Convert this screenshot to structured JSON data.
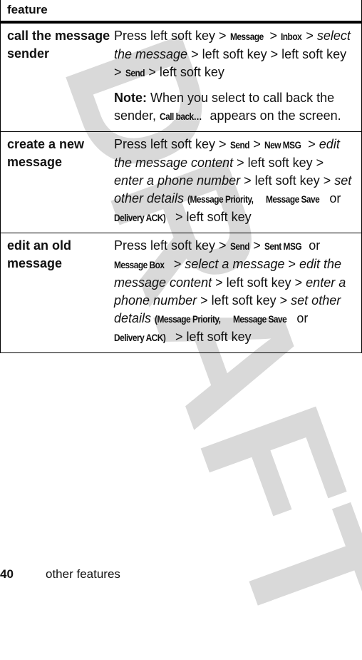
{
  "watermark": "DRAFT",
  "table": {
    "header": "feature",
    "rows": [
      {
        "feature": "call the message sender",
        "steps": [
          {
            "t": "text",
            "v": "Press left soft key > "
          },
          {
            "t": "ui",
            "v": "Message"
          },
          {
            "t": "text",
            "v": " > "
          },
          {
            "t": "ui",
            "v": "Inbox"
          },
          {
            "t": "text",
            "v": " > "
          },
          {
            "t": "em",
            "v": "select the message"
          },
          {
            "t": "text",
            "v": " > left soft key > left soft key > "
          },
          {
            "t": "ui",
            "v": "Send"
          },
          {
            "t": "text",
            "v": " > left soft key"
          }
        ],
        "note_label": "Note:",
        "note": [
          {
            "t": "text",
            "v": " When you select to call back the sender, "
          },
          {
            "t": "ui",
            "v": "Call back…"
          },
          {
            "t": "text",
            "v": " appears on the screen."
          }
        ]
      },
      {
        "feature": "create a new message",
        "steps": [
          {
            "t": "text",
            "v": "Press left soft key > "
          },
          {
            "t": "ui",
            "v": "Send"
          },
          {
            "t": "text",
            "v": " > "
          },
          {
            "t": "ui",
            "v": "New MSG"
          },
          {
            "t": "text",
            "v": " > "
          },
          {
            "t": "em",
            "v": "edit the message content"
          },
          {
            "t": "text",
            "v": " > left soft key > "
          },
          {
            "t": "em",
            "v": "enter a phone number"
          },
          {
            "t": "text",
            "v": " > left soft key > "
          },
          {
            "t": "em",
            "v": "set other details"
          },
          {
            "t": "text",
            "v": " "
          },
          {
            "t": "ui",
            "v": "(Message Priority,"
          },
          {
            "t": "text",
            "v": " "
          },
          {
            "t": "ui",
            "v": "Message Save"
          },
          {
            "t": "text",
            "v": " or "
          },
          {
            "t": "ui",
            "v": "Delivery ACK)"
          },
          {
            "t": "text",
            "v": " > left soft key"
          }
        ]
      },
      {
        "feature": "edit an old message",
        "steps": [
          {
            "t": "text",
            "v": "Press left soft key > "
          },
          {
            "t": "ui",
            "v": "Send"
          },
          {
            "t": "text",
            "v": " > "
          },
          {
            "t": "ui",
            "v": "Sent MSG"
          },
          {
            "t": "text",
            "v": " or "
          },
          {
            "t": "ui",
            "v": "Message Box"
          },
          {
            "t": "text",
            "v": " > "
          },
          {
            "t": "em",
            "v": "select a message"
          },
          {
            "t": "text",
            "v": " > "
          },
          {
            "t": "em",
            "v": "edit the message content"
          },
          {
            "t": "text",
            "v": " > left soft key > "
          },
          {
            "t": "em",
            "v": "enter a phone number"
          },
          {
            "t": "text",
            "v": " > left soft key > "
          },
          {
            "t": "em",
            "v": "set other details"
          },
          {
            "t": "text",
            "v": " "
          },
          {
            "t": "ui",
            "v": "(Message Priority,"
          },
          {
            "t": "text",
            "v": " "
          },
          {
            "t": "ui",
            "v": "Message Save"
          },
          {
            "t": "text",
            "v": " or "
          },
          {
            "t": "ui",
            "v": "Delivery ACK)"
          },
          {
            "t": "text",
            "v": " > left soft key"
          }
        ]
      }
    ]
  },
  "footer": {
    "page_number": "40",
    "section_title": "other features"
  }
}
